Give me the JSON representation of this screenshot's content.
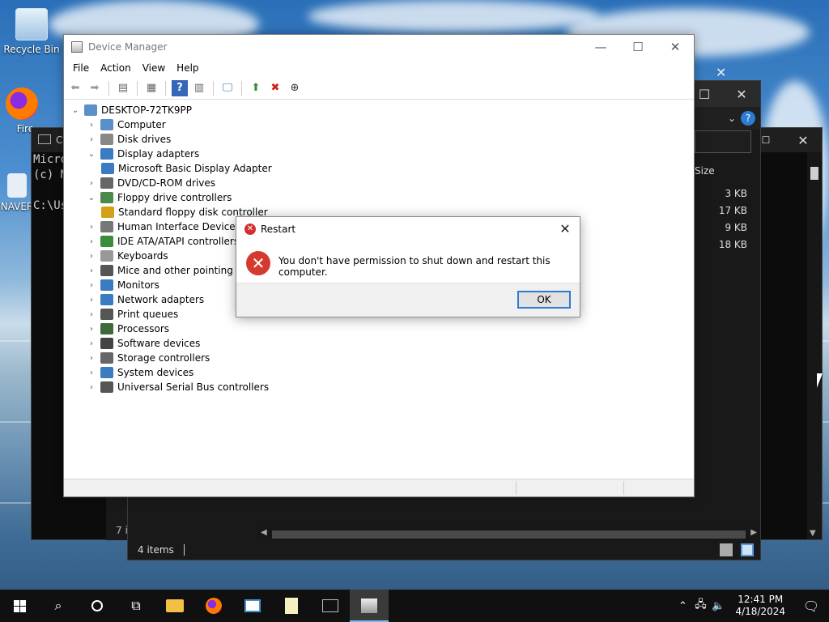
{
  "desktop": {
    "icons": [
      {
        "label": "Recycle Bin"
      },
      {
        "label": "Fire"
      },
      {
        "label": "NAVER"
      }
    ]
  },
  "explorer": {
    "size_header": "Size",
    "sizes": [
      "3 KB",
      "17 KB",
      "9 KB",
      "18 KB"
    ],
    "status_items": "4 items"
  },
  "console": {
    "title": "C",
    "lines": "Micro\n(c) M\n\nC:\\Us",
    "status": "7 i"
  },
  "device_manager": {
    "title": "Device Manager",
    "menu": [
      "File",
      "Action",
      "View",
      "Help"
    ],
    "tree": {
      "root": "DESKTOP-72TK9PP",
      "items": [
        {
          "label": "Computer",
          "expanded": false
        },
        {
          "label": "Disk drives",
          "expanded": false
        },
        {
          "label": "Display adapters",
          "expanded": true
        },
        {
          "label": "Microsoft Basic Display Adapter",
          "child": true
        },
        {
          "label": "DVD/CD-ROM drives",
          "expanded": false
        },
        {
          "label": "Floppy drive controllers",
          "expanded": true
        },
        {
          "label": "Standard floppy disk controller",
          "child": true
        },
        {
          "label": "Human Interface Devices",
          "expanded": false
        },
        {
          "label": "IDE ATA/ATAPI controllers",
          "expanded": false
        },
        {
          "label": "Keyboards",
          "expanded": false
        },
        {
          "label": "Mice and other pointing devices",
          "expanded": false
        },
        {
          "label": "Monitors",
          "expanded": false
        },
        {
          "label": "Network adapters",
          "expanded": false
        },
        {
          "label": "Print queues",
          "expanded": false
        },
        {
          "label": "Processors",
          "expanded": false
        },
        {
          "label": "Software devices",
          "expanded": false
        },
        {
          "label": "Storage controllers",
          "expanded": false
        },
        {
          "label": "System devices",
          "expanded": false
        },
        {
          "label": "Universal Serial Bus controllers",
          "expanded": false
        }
      ]
    }
  },
  "dialog": {
    "title": "Restart",
    "message": "You don't have permission to shut down and restart this computer.",
    "ok_label": "OK"
  },
  "taskbar": {
    "time": "12:41 PM",
    "date": "4/18/2024"
  },
  "colors": {
    "accent": "#2f7ad6",
    "error": "#d53a2e",
    "taskbar": "#101010"
  }
}
